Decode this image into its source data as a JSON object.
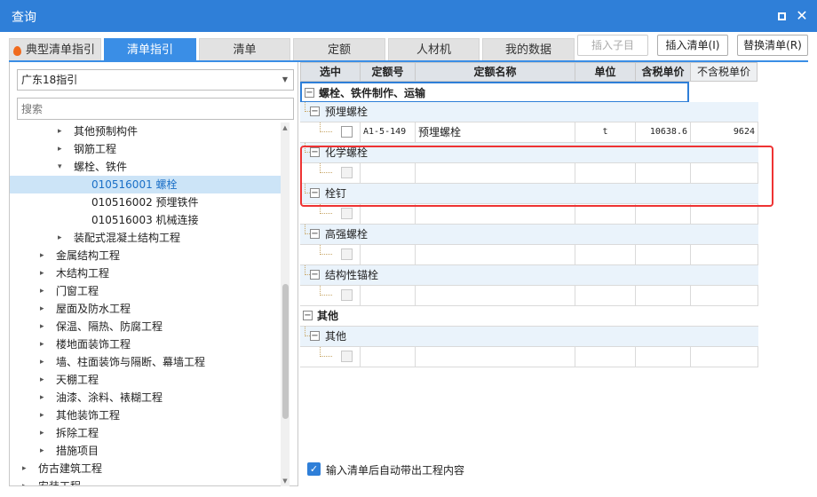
{
  "window": {
    "title": "查询",
    "maximize_icon": "square-icon",
    "close_icon": "close-icon"
  },
  "tabs": [
    {
      "label": "典型清单指引",
      "active": false
    },
    {
      "label": "清单指引",
      "active": true
    },
    {
      "label": "清单",
      "active": false
    },
    {
      "label": "定额",
      "active": false
    },
    {
      "label": "人材机",
      "active": false
    },
    {
      "label": "我的数据",
      "active": false
    }
  ],
  "toolbar": {
    "insert_child": "插入子目",
    "insert_list": "插入清单(I)",
    "replace_list": "替换清单(R)"
  },
  "left": {
    "select_value": "广东18指引",
    "search_placeholder": "搜索",
    "tree": [
      {
        "label": "其他预制构件",
        "toggle": "▸",
        "level": 2
      },
      {
        "label": "钢筋工程",
        "toggle": "▸",
        "level": 2
      },
      {
        "label": "螺栓、铁件",
        "toggle": "▾",
        "level": 2
      },
      {
        "label": "010516001  螺栓",
        "toggle": "",
        "level": 3,
        "selected": true
      },
      {
        "label": "010516002  预埋铁件",
        "toggle": "",
        "level": 3
      },
      {
        "label": "010516003  机械连接",
        "toggle": "",
        "level": 3
      },
      {
        "label": "装配式混凝土结构工程",
        "toggle": "▸",
        "level": 2
      },
      {
        "label": "金属结构工程",
        "toggle": "▸",
        "level": 1
      },
      {
        "label": "木结构工程",
        "toggle": "▸",
        "level": 1
      },
      {
        "label": "门窗工程",
        "toggle": "▸",
        "level": 1
      },
      {
        "label": "屋面及防水工程",
        "toggle": "▸",
        "level": 1
      },
      {
        "label": "保温、隔热、防腐工程",
        "toggle": "▸",
        "level": 1
      },
      {
        "label": "楼地面装饰工程",
        "toggle": "▸",
        "level": 1
      },
      {
        "label": "墙、柱面装饰与隔断、幕墙工程",
        "toggle": "▸",
        "level": 1
      },
      {
        "label": "天棚工程",
        "toggle": "▸",
        "level": 1
      },
      {
        "label": "油漆、涂料、裱糊工程",
        "toggle": "▸",
        "level": 1
      },
      {
        "label": "其他装饰工程",
        "toggle": "▸",
        "level": 1
      },
      {
        "label": "拆除工程",
        "toggle": "▸",
        "level": 1
      },
      {
        "label": "措施项目",
        "toggle": "▸",
        "level": 1
      },
      {
        "label": "仿古建筑工程",
        "toggle": "▸",
        "level": 0
      },
      {
        "label": "安装工程",
        "toggle": "▸",
        "level": 0
      }
    ]
  },
  "grid": {
    "headers": [
      "选中",
      "定额号",
      "定额名称",
      "单位",
      "含税单价",
      "不含税单价"
    ],
    "rows": [
      {
        "type": "group",
        "label": "螺栓、铁件制作、运输"
      },
      {
        "type": "sub",
        "label": "预埋螺栓"
      },
      {
        "type": "item",
        "code": "A1-5-149",
        "name": "预埋螺栓",
        "unit": "t",
        "price_tax": "10638.6",
        "price_notax": "9624"
      },
      {
        "type": "sub",
        "label": "化学螺栓"
      },
      {
        "type": "empty"
      },
      {
        "type": "sub",
        "label": "栓钉"
      },
      {
        "type": "empty"
      },
      {
        "type": "sub",
        "label": "高强螺栓"
      },
      {
        "type": "empty"
      },
      {
        "type": "sub",
        "label": "结构性锚栓"
      },
      {
        "type": "empty"
      },
      {
        "type": "group",
        "label": "其他"
      },
      {
        "type": "sub",
        "label": "其他"
      },
      {
        "type": "empty"
      }
    ]
  },
  "footer": {
    "auto_bring_label": "输入清单后自动带出工程内容",
    "checked": true
  }
}
